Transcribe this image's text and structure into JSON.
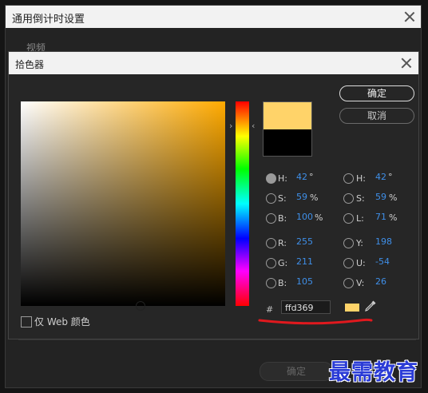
{
  "outer_dialog": {
    "title": "通用倒计时设置",
    "section_label": "视频",
    "ok_label": "确定"
  },
  "picker": {
    "title": "拾色器",
    "ok_label": "确定",
    "cancel_label": "取消",
    "new_color": "#ffd369",
    "old_color": "#000000",
    "base_hue_color": "#ffaa00",
    "hsb": [
      {
        "label": "H:",
        "value": "42",
        "unit": "°",
        "checked": true
      },
      {
        "label": "S:",
        "value": "59",
        "unit": "%",
        "checked": false
      },
      {
        "label": "B:",
        "value": "100",
        "unit": "%",
        "checked": false
      }
    ],
    "rgb": [
      {
        "label": "R:",
        "value": "255",
        "unit": "",
        "checked": false
      },
      {
        "label": "G:",
        "value": "211",
        "unit": "",
        "checked": false
      },
      {
        "label": "B:",
        "value": "105",
        "unit": "",
        "checked": false
      }
    ],
    "hsl": [
      {
        "label": "H:",
        "value": "42",
        "unit": "°",
        "checked": false
      },
      {
        "label": "S:",
        "value": "59",
        "unit": "%",
        "checked": false
      },
      {
        "label": "L:",
        "value": "71",
        "unit": "%",
        "checked": false
      }
    ],
    "yuv": [
      {
        "label": "Y:",
        "value": "198",
        "unit": "",
        "checked": false
      },
      {
        "label": "U:",
        "value": "-54",
        "unit": "",
        "checked": false
      },
      {
        "label": "V:",
        "value": "26",
        "unit": "",
        "checked": false
      }
    ],
    "hash_label": "#",
    "hex_value": "ffd369",
    "web_only_label": "仅 Web 颜色",
    "annotation_color": "#e0191e"
  },
  "watermark": "最需教育"
}
